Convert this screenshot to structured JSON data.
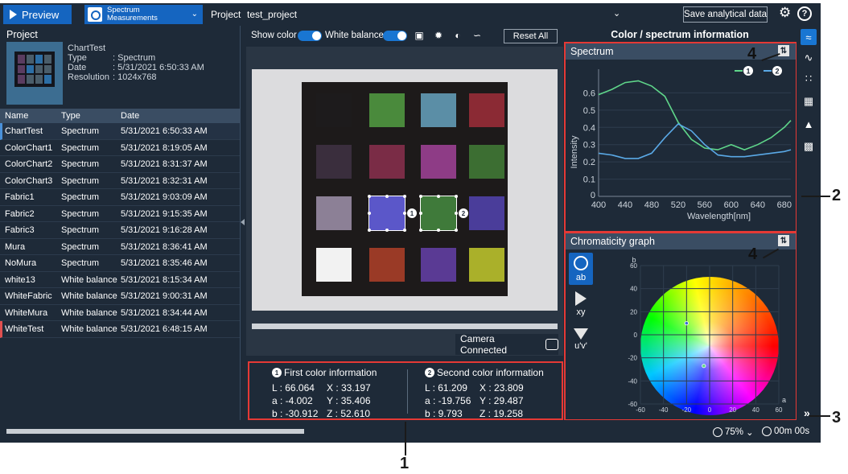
{
  "top": {
    "preview_label": "Preview",
    "spectrum_label_line1": "Spectrum",
    "spectrum_label_line2": "Measurements",
    "project_label": "Project",
    "project_name": "test_project",
    "save_label": "Save analytical data"
  },
  "left": {
    "title": "Project",
    "thumb_name": "ChartTest",
    "meta": [
      {
        "k": "Type",
        "v": ": Spectrum"
      },
      {
        "k": "Date",
        "v": ": 5/31/2021 6:50:33 AM"
      },
      {
        "k": "Resolution",
        "v": ": 1024x768"
      }
    ],
    "columns": [
      "Name",
      "Type",
      "Date"
    ],
    "rows": [
      [
        "ChartTest",
        "Spectrum",
        "5/31/2021 6:50:33 AM"
      ],
      [
        "ColorChart1",
        "Spectrum",
        "5/31/2021 8:19:05 AM"
      ],
      [
        "ColorChart2",
        "Spectrum",
        "5/31/2021 8:31:37 AM"
      ],
      [
        "ColorChart3",
        "Spectrum",
        "5/31/2021 8:32:31 AM"
      ],
      [
        "Fabric1",
        "Spectrum",
        "5/31/2021 9:03:09 AM"
      ],
      [
        "Fabric2",
        "Spectrum",
        "5/31/2021 9:15:35 AM"
      ],
      [
        "Fabric3",
        "Spectrum",
        "5/31/2021 9:16:28 AM"
      ],
      [
        "Mura",
        "Spectrum",
        "5/31/2021 8:36:41 AM"
      ],
      [
        "NoMura",
        "Spectrum",
        "5/31/2021 8:35:46 AM"
      ],
      [
        "white13",
        "White balance",
        "5/31/2021 8:15:34 AM"
      ],
      [
        "WhiteFabric",
        "White balance",
        "5/31/2021 9:00:31 AM"
      ],
      [
        "WhiteMura",
        "White balance",
        "5/31/2021 8:34:44 AM"
      ],
      [
        "WhiteTest",
        "White balance",
        "5/31/2021 6:48:15 AM"
      ]
    ]
  },
  "center": {
    "show_color": "Show color",
    "white_balance": "White balance",
    "reset_label": "Reset All",
    "camera_status": "Camera Connected",
    "first": {
      "num": "1",
      "title": "First color information",
      "values": [
        "L : 66.064",
        "X : 33.197",
        "a : -4.002",
        "Y : 35.406",
        "b : -30.912",
        "Z : 52.610"
      ]
    },
    "second": {
      "num": "2",
      "title": "Second color information",
      "values": [
        "L : 61.209",
        "X : 23.809",
        "a : -19.756",
        "Y : 29.487",
        "b : 9.793",
        "Z : 19.258"
      ]
    },
    "marker1": "1",
    "marker2": "2"
  },
  "right": {
    "title": "Color / spectrum information",
    "spectrum_head": "Spectrum",
    "chroma_head": "Chromaticity graph",
    "mode_ab": "ab",
    "mode_xy": "xy",
    "mode_uv": "u'v'"
  },
  "status": {
    "zoom": "75%",
    "timer": "00m 00s"
  },
  "callouts": {
    "c1": "1",
    "c2": "2",
    "c3": "3",
    "c4a": "4",
    "c4b": "4"
  },
  "colors": {
    "series1": "#5fd68a",
    "series2": "#5aa9e6",
    "accent": "#1565c0",
    "highlight": "#e53935"
  },
  "chart_data": [
    {
      "type": "line",
      "title": "Spectrum",
      "xlabel": "Wavelength[nm]",
      "ylabel": "Intensity",
      "xlim": [
        400,
        690
      ],
      "ylim": [
        0,
        0.7
      ],
      "xticks": [
        400,
        440,
        480,
        520,
        560,
        600,
        640,
        680
      ],
      "yticks": [
        0.1,
        0.2,
        0.3,
        0.4,
        0.5,
        0.6
      ],
      "ytick_labels": [
        "0.1",
        "0.2",
        "0.3",
        "0.4",
        "0.5",
        "0.6"
      ],
      "series": [
        {
          "name": "1",
          "color": "#5fd68a",
          "x": [
            400,
            420,
            440,
            460,
            480,
            500,
            520,
            540,
            560,
            580,
            600,
            620,
            640,
            660,
            680,
            690
          ],
          "y": [
            0.59,
            0.62,
            0.66,
            0.67,
            0.64,
            0.58,
            0.43,
            0.33,
            0.28,
            0.27,
            0.3,
            0.27,
            0.3,
            0.34,
            0.4,
            0.44
          ]
        },
        {
          "name": "2",
          "color": "#5aa9e6",
          "x": [
            400,
            420,
            440,
            460,
            480,
            500,
            520,
            540,
            560,
            580,
            600,
            620,
            640,
            660,
            680,
            690
          ],
          "y": [
            0.25,
            0.24,
            0.22,
            0.22,
            0.25,
            0.34,
            0.42,
            0.38,
            0.3,
            0.24,
            0.23,
            0.23,
            0.24,
            0.25,
            0.26,
            0.27
          ]
        }
      ]
    },
    {
      "type": "scatter",
      "title": "Chromaticity graph",
      "xlabel": "a",
      "ylabel": "b",
      "xlim": [
        -60,
        60
      ],
      "ylim": [
        -60,
        60
      ],
      "xticks": [
        -60,
        -40,
        -20,
        0,
        20,
        40,
        60
      ],
      "yticks": [
        60,
        40,
        20,
        0,
        -20,
        -40,
        -60
      ],
      "points": [
        {
          "label": "1",
          "a": -20,
          "b": 10,
          "color": "#3a6ad9"
        },
        {
          "label": "2",
          "a": -5,
          "b": -27,
          "color": "#5fd68a"
        }
      ]
    }
  ]
}
